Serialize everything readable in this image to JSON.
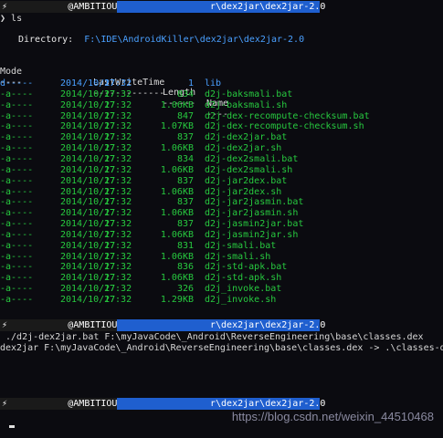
{
  "prompts": [
    {
      "chevron": "⚡",
      "user": "@AMBITIOUSNESS",
      "path": "r\\dex2jar\\dex2jar-2.0"
    },
    {
      "chevron": "⚡",
      "user": "@AMBITIOUSNESS",
      "path": "r\\dex2jar\\dex2jar-2.0"
    },
    {
      "chevron": "⚡",
      "user": "@AMBITIOUSNESS",
      "path": "r\\dex2jar\\dex2jar-2.0"
    }
  ],
  "command1": "ls",
  "directory_label": "Directory:",
  "directory_path": "F:\\IDE\\AndroidKiller\\dex2jar\\dex2jar-2.0",
  "headers": {
    "mode": "Mode",
    "lastwritetime": "LastWriteTime",
    "length": "Length",
    "name": "Name"
  },
  "header_underline": {
    "mode": "----",
    "lastwritetime": "-------------",
    "length": "------",
    "name": "----"
  },
  "entries": [
    {
      "mode": "d-----",
      "date": "2014/10/27",
      "time": "17:32",
      "length": "1",
      "name": "lib"
    },
    {
      "mode": "-a----",
      "date": "2014/10/27",
      "time": "17:32",
      "length": "834",
      "name": "d2j-baksmali.bat"
    },
    {
      "mode": "-a----",
      "date": "2014/10/27",
      "time": "17:32",
      "length": "1.06KB",
      "name": "d2j-baksmali.sh"
    },
    {
      "mode": "-a----",
      "date": "2014/10/27",
      "time": "17:32",
      "length": "847",
      "name": "d2j-dex-recompute-checksum.bat"
    },
    {
      "mode": "-a----",
      "date": "2014/10/27",
      "time": "17:32",
      "length": "1.07KB",
      "name": "d2j-dex-recompute-checksum.sh"
    },
    {
      "mode": "-a----",
      "date": "2014/10/27",
      "time": "17:32",
      "length": "837",
      "name": "d2j-dex2jar.bat"
    },
    {
      "mode": "-a----",
      "date": "2014/10/27",
      "time": "17:32",
      "length": "1.06KB",
      "name": "d2j-dex2jar.sh"
    },
    {
      "mode": "-a----",
      "date": "2014/10/27",
      "time": "17:32",
      "length": "834",
      "name": "d2j-dex2smali.bat"
    },
    {
      "mode": "-a----",
      "date": "2014/10/27",
      "time": "17:32",
      "length": "1.06KB",
      "name": "d2j-dex2smali.sh"
    },
    {
      "mode": "-a----",
      "date": "2014/10/27",
      "time": "17:32",
      "length": "837",
      "name": "d2j-jar2dex.bat"
    },
    {
      "mode": "-a----",
      "date": "2014/10/27",
      "time": "17:32",
      "length": "1.06KB",
      "name": "d2j-jar2dex.sh"
    },
    {
      "mode": "-a----",
      "date": "2014/10/27",
      "time": "17:32",
      "length": "837",
      "name": "d2j-jar2jasmin.bat"
    },
    {
      "mode": "-a----",
      "date": "2014/10/27",
      "time": "17:32",
      "length": "1.06KB",
      "name": "d2j-jar2jasmin.sh"
    },
    {
      "mode": "-a----",
      "date": "2014/10/27",
      "time": "17:32",
      "length": "837",
      "name": "d2j-jasmin2jar.bat"
    },
    {
      "mode": "-a----",
      "date": "2014/10/27",
      "time": "17:32",
      "length": "1.06KB",
      "name": "d2j-jasmin2jar.sh"
    },
    {
      "mode": "-a----",
      "date": "2014/10/27",
      "time": "17:32",
      "length": "831",
      "name": "d2j-smali.bat"
    },
    {
      "mode": "-a----",
      "date": "2014/10/27",
      "time": "17:32",
      "length": "1.06KB",
      "name": "d2j-smali.sh"
    },
    {
      "mode": "-a----",
      "date": "2014/10/27",
      "time": "17:32",
      "length": "836",
      "name": "d2j-std-apk.bat"
    },
    {
      "mode": "-a----",
      "date": "2014/10/27",
      "time": "17:32",
      "length": "1.06KB",
      "name": "d2j-std-apk.sh"
    },
    {
      "mode": "-a----",
      "date": "2014/10/27",
      "time": "17:32",
      "length": "326",
      "name": "d2j_invoke.bat"
    },
    {
      "mode": "-a----",
      "date": "2014/10/27",
      "time": "17:32",
      "length": "1.29KB",
      "name": "d2j_invoke.sh"
    }
  ],
  "command2": " ./d2j-dex2jar.bat F:\\myJavaCode\\_Android\\ReverseEngineering\\base\\classes.dex",
  "output2": "dex2jar F:\\myJavaCode\\_Android\\ReverseEngineering\\base\\classes.dex -> .\\classes-dex2jar.jar",
  "watermark": "https://blog.csdn.net/weixin_44510468",
  "colors": {
    "background": "#0b0b10",
    "path_segment": "#1f5fcf",
    "directory_mode": "#4aa0ff",
    "file_mode": "#27c93f"
  }
}
